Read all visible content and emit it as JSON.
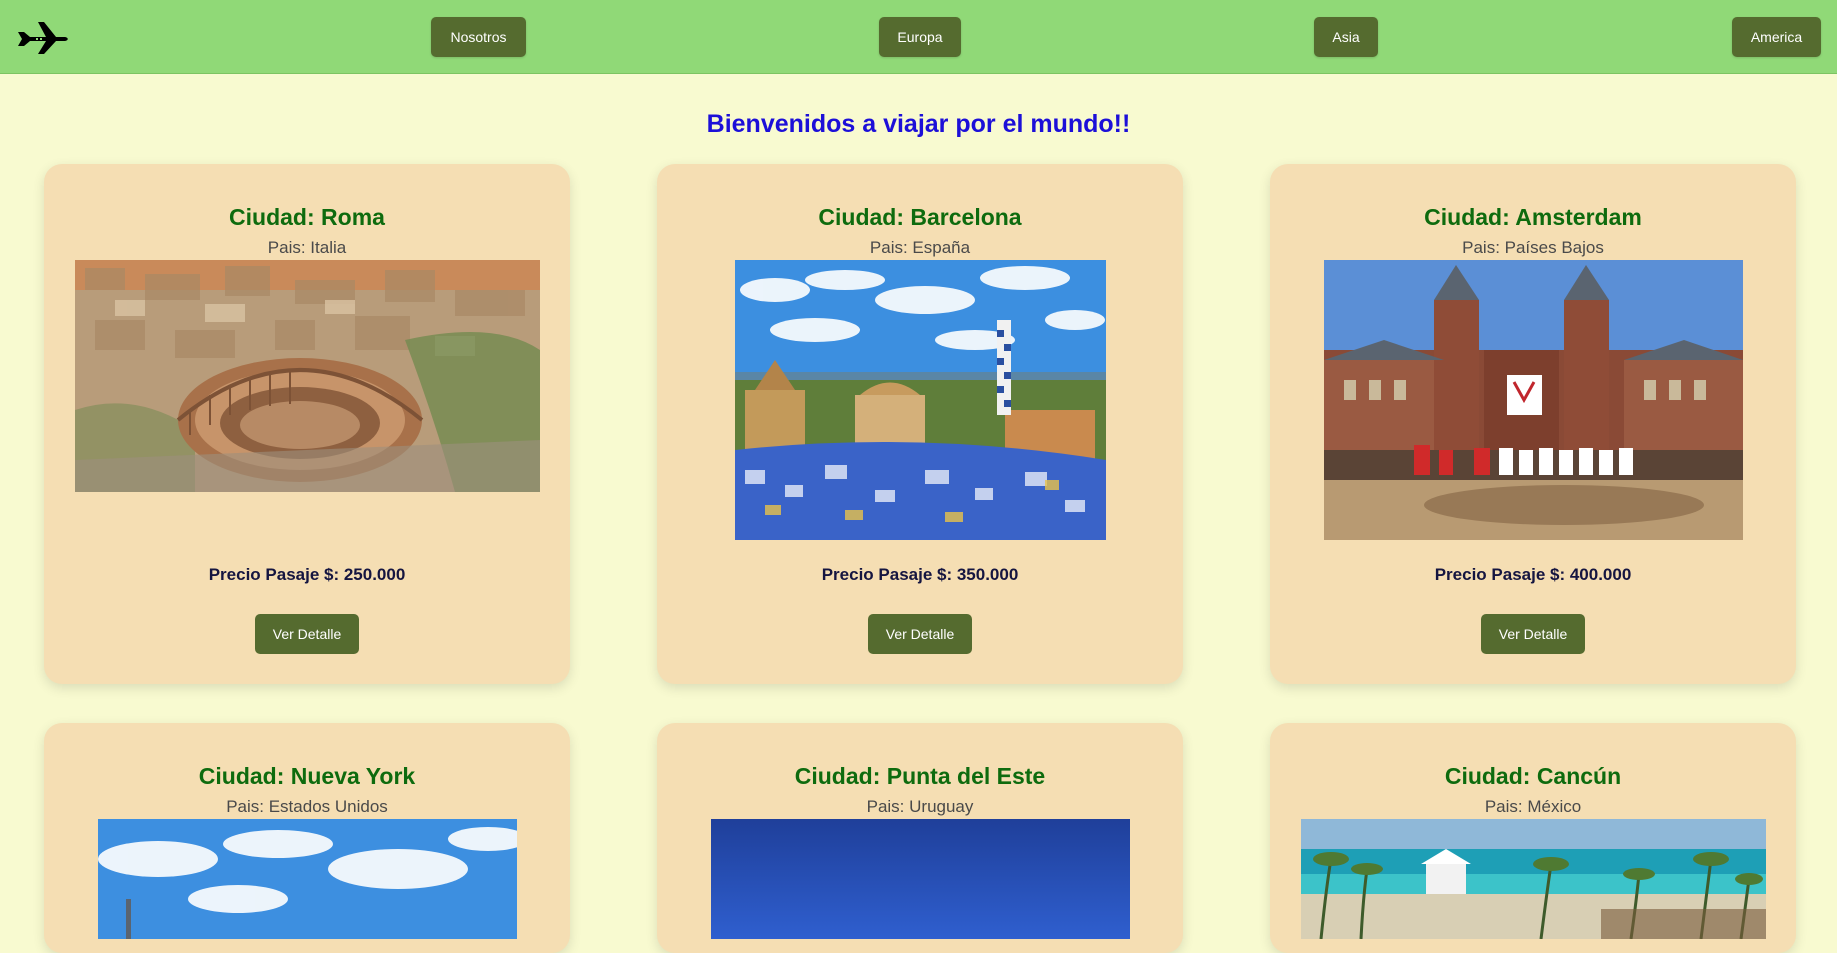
{
  "header": {
    "logo_icon": "airplane-icon",
    "nav": [
      {
        "label": "Nosotros"
      },
      {
        "label": "Europa"
      },
      {
        "label": "Asia"
      },
      {
        "label": "America"
      }
    ]
  },
  "welcome": "Bienvenidos a viajar por el mundo!!",
  "colors": {
    "background": "#f8fad0",
    "topbar": "#90d977",
    "button": "#556b2f",
    "card": "#f5deb3",
    "title": "#0e6b0e",
    "welcome": "#1c0fd8"
  },
  "cards": [
    {
      "title": "Ciudad: Roma",
      "country": "Pais: Italia",
      "price": "Precio Pasaje $: 250.000",
      "button": "Ver Detalle",
      "image": "colosseum-photo"
    },
    {
      "title": "Ciudad: Barcelona",
      "country": "Pais: España",
      "price": "Precio Pasaje $: 350.000",
      "button": "Ver Detalle",
      "image": "park-guell-photo"
    },
    {
      "title": "Ciudad: Amsterdam",
      "country": "Pais: Países Bajos",
      "price": "Precio Pasaje $: 400.000",
      "button": "Ver Detalle",
      "image": "rijksmuseum-photo"
    },
    {
      "title": "Ciudad: Nueva York",
      "country": "Pais: Estados Unidos",
      "image": "new-york-sky-photo"
    },
    {
      "title": "Ciudad: Punta del Este",
      "country": "Pais: Uruguay",
      "image": "punta-del-este-sky-photo"
    },
    {
      "title": "Ciudad: Cancún",
      "country": "Pais: México",
      "image": "cancun-beach-photo"
    }
  ]
}
